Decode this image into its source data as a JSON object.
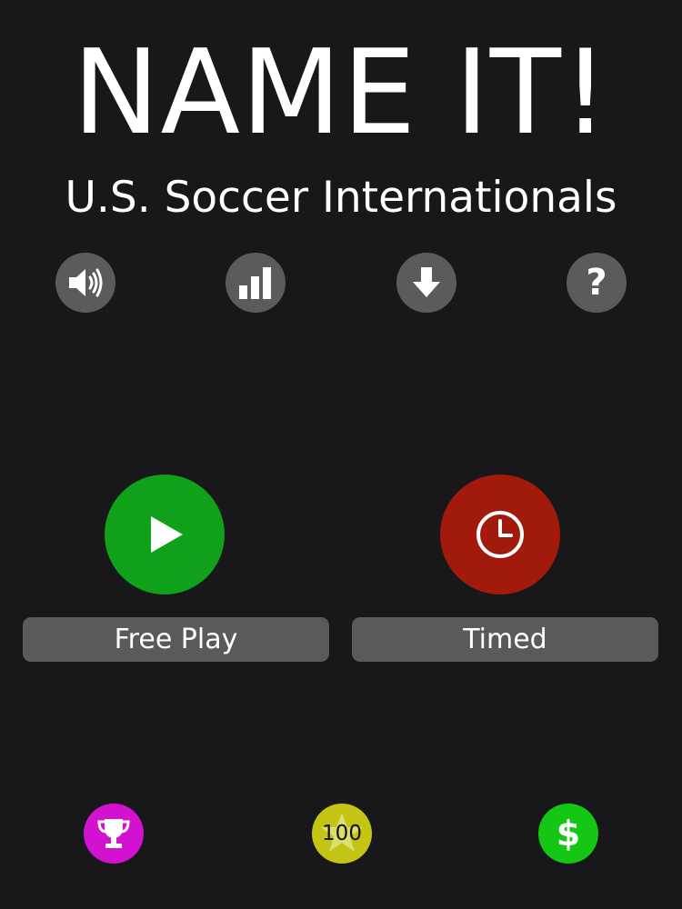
{
  "header": {
    "title": "NAME IT!",
    "subtitle": "U.S. Soccer Internationals"
  },
  "top_icons": [
    {
      "name": "sound",
      "icon": "speaker-icon"
    },
    {
      "name": "stats",
      "icon": "bar-chart-icon"
    },
    {
      "name": "download",
      "icon": "down-arrow-icon"
    },
    {
      "name": "help",
      "icon": "question-icon",
      "glyph": "?"
    }
  ],
  "modes": {
    "free_play": {
      "label": "Free Play",
      "icon": "play-icon",
      "color": "#11a01a"
    },
    "timed": {
      "label": "Timed",
      "icon": "clock-icon",
      "color": "#a11a0c"
    }
  },
  "bottom_icons": {
    "trophy": {
      "icon": "trophy-icon",
      "color": "#d312d0"
    },
    "hundred": {
      "icon": "star-icon",
      "text": "100",
      "color": "#c4c415"
    },
    "dollar": {
      "icon": "dollar-icon",
      "glyph": "$",
      "color": "#14c714"
    }
  },
  "colors": {
    "background": "#18181a",
    "icon_bg": "#5b5b5e",
    "label_bar": "#5a5a5d"
  }
}
